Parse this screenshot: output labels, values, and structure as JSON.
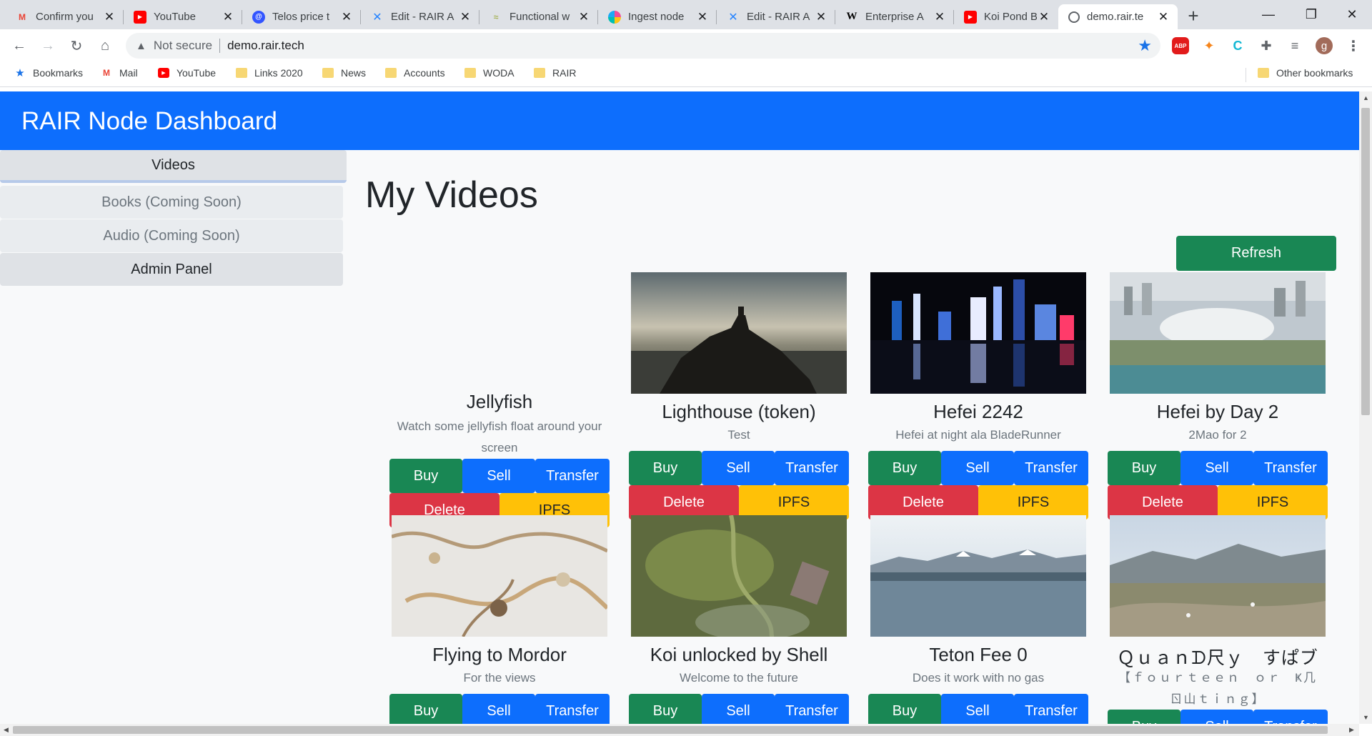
{
  "browser": {
    "tabs": [
      {
        "title": "Confirm you",
        "icon": "gmail-icon",
        "active": false
      },
      {
        "title": "YouTube",
        "icon": "youtube-icon",
        "active": false
      },
      {
        "title": "Telos price t",
        "icon": "telos-icon",
        "active": false
      },
      {
        "title": "Edit - RAIR A",
        "icon": "confluence-icon",
        "active": false
      },
      {
        "title": "Functional w",
        "icon": "functional-icon",
        "active": false
      },
      {
        "title": "Ingest node",
        "icon": "elastic-icon",
        "active": false
      },
      {
        "title": "Edit - RAIR A",
        "icon": "confluence-icon",
        "active": false
      },
      {
        "title": "Enterprise A",
        "icon": "wikipedia-icon",
        "active": false
      },
      {
        "title": "Koi Pond Ba",
        "icon": "youtube-icon",
        "active": false
      },
      {
        "title": "demo.rair.te",
        "icon": "globe-icon",
        "active": true
      }
    ],
    "address": {
      "security_label": "Not secure",
      "url": "demo.rair.tech"
    },
    "profile_initial": "g",
    "bookmarks": [
      {
        "label": "Bookmarks",
        "icon": "star-icon"
      },
      {
        "label": "Mail",
        "icon": "gmail-icon"
      },
      {
        "label": "YouTube",
        "icon": "youtube-icon"
      },
      {
        "label": "Links 2020",
        "icon": "folder-icon"
      },
      {
        "label": "News",
        "icon": "folder-icon"
      },
      {
        "label": "Accounts",
        "icon": "folder-icon"
      },
      {
        "label": "WODA",
        "icon": "folder-icon"
      },
      {
        "label": "RAIR",
        "icon": "folder-icon"
      }
    ],
    "other_bookmarks": "Other bookmarks"
  },
  "app": {
    "title": "RAIR Node Dashboard",
    "nav": [
      {
        "label": "Videos"
      },
      {
        "label": "Books (Coming Soon)"
      },
      {
        "label": "Audio (Coming Soon)"
      },
      {
        "label": "Admin Panel"
      }
    ],
    "page_title": "My Videos",
    "refresh_label": "Refresh",
    "buttons": {
      "buy": "Buy",
      "sell": "Sell",
      "transfer": "Transfer",
      "delete": "Delete",
      "ipfs": "IPFS"
    },
    "videos": [
      {
        "title": "Jellyfish",
        "description": "Watch some jellyfish float around your screen",
        "thumbnail": "none"
      },
      {
        "title": "Lighthouse (token)",
        "description": "Test",
        "thumbnail": "lighthouse-at-dusk"
      },
      {
        "title": "Hefei 2242",
        "description": "Hefei at night ala BladeRunner",
        "thumbnail": "city-night-skyline"
      },
      {
        "title": "Hefei by Day 2",
        "description": "2Mao for 2",
        "thumbnail": "city-aerial-day"
      },
      {
        "title": "Flying to Mordor",
        "description": "For the views",
        "thumbnail": "snowy-terrain-aerial"
      },
      {
        "title": "Koi unlocked by Shell",
        "description": "Welcome to the future",
        "thumbnail": "pond-aerial"
      },
      {
        "title": "Teton Fee 0",
        "description": "Does it work with no gas",
        "thumbnail": "mountain-lake"
      },
      {
        "title": "Ｑｕａｎᗪ尺ｙ　すぱブ",
        "description": "【ｆｏｕｒｔｅｅｎ　ｏｒ　Ҝ几ㄖ山ｔｉｎｇ】",
        "thumbnail": "hillside-mountains"
      }
    ]
  }
}
